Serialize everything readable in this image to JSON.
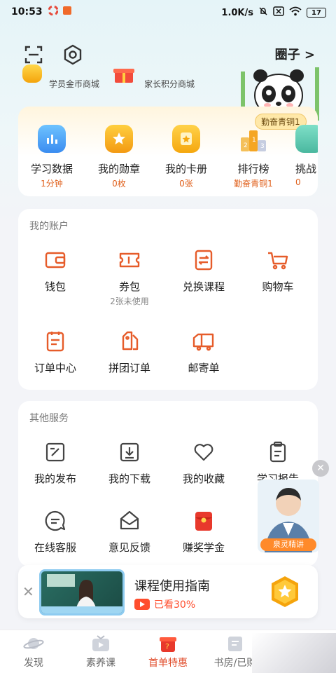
{
  "status_bar": {
    "time": "10:53",
    "net_speed": "1.0K/s",
    "battery": "17"
  },
  "header": {
    "circle_label": "圈子 >"
  },
  "malls": {
    "student": "学员金币商城",
    "parent": "家长积分商城"
  },
  "achievements": {
    "rank_badge": "勤奋青铜1",
    "items": [
      {
        "label": "学习数据",
        "sub": "1分钟"
      },
      {
        "label": "我的勋章",
        "sub": "0枚"
      },
      {
        "label": "我的卡册",
        "sub": "0张"
      },
      {
        "label": "排行榜",
        "sub": "勤奋青铜1"
      },
      {
        "label": "挑战",
        "sub": "0"
      }
    ]
  },
  "account": {
    "title": "我的账户",
    "items": [
      {
        "label": "钱包",
        "sub": ""
      },
      {
        "label": "券包",
        "sub": "2张未使用"
      },
      {
        "label": "兑换课程",
        "sub": ""
      },
      {
        "label": "购物车",
        "sub": ""
      },
      {
        "label": "订单中心",
        "sub": ""
      },
      {
        "label": "拼团订单",
        "sub": ""
      },
      {
        "label": "邮寄单",
        "sub": ""
      }
    ]
  },
  "other": {
    "title": "其他服务",
    "items": [
      {
        "label": "我的发布"
      },
      {
        "label": "我的下载"
      },
      {
        "label": "我的收藏"
      },
      {
        "label": "学习报告"
      },
      {
        "label": "在线客服"
      },
      {
        "label": "意见反馈"
      },
      {
        "label": "赚奖学金"
      }
    ]
  },
  "floating": {
    "tag": "泉灵精讲"
  },
  "guide": {
    "title": "课程使用指南",
    "progress_text": "已看30%",
    "progress": 0.3
  },
  "tabs": [
    {
      "label": "发现"
    },
    {
      "label": "素养课"
    },
    {
      "label": "首单特惠"
    },
    {
      "label": "书房/已购"
    }
  ],
  "colors": {
    "accent": "#e0611d",
    "active_tab": "#e04b2a",
    "progress_red": "#ff4d2d"
  }
}
